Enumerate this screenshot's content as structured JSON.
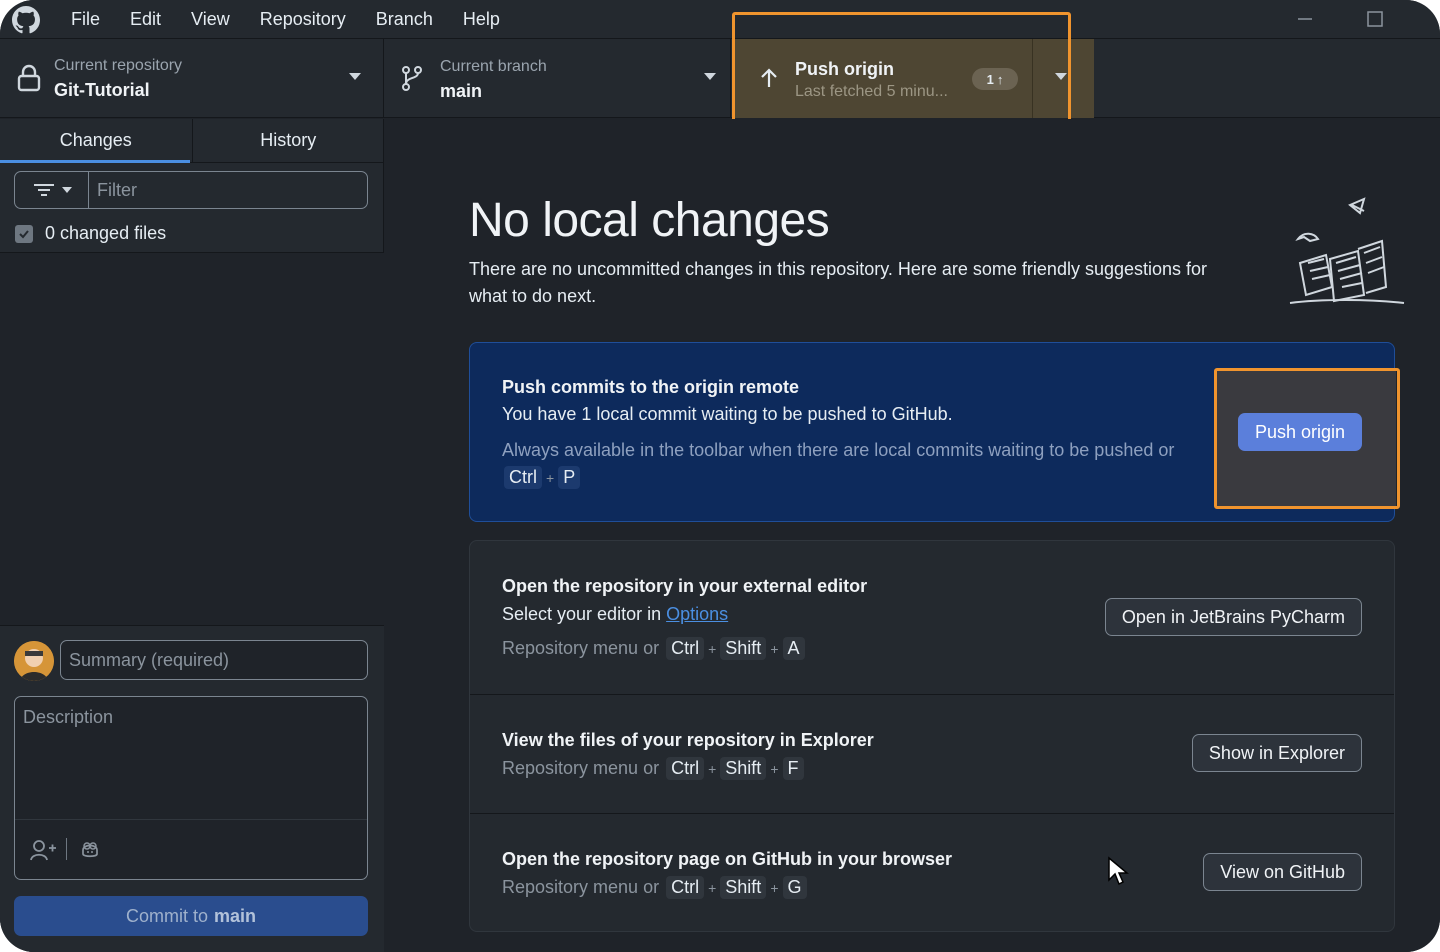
{
  "menu": [
    "File",
    "Edit",
    "View",
    "Repository",
    "Branch",
    "Help"
  ],
  "toolbar": {
    "repo": {
      "label": "Current repository",
      "value": "Git-Tutorial"
    },
    "branch": {
      "label": "Current branch",
      "value": "main"
    },
    "push": {
      "title": "Push origin",
      "subtitle": "Last fetched 5 minu...",
      "badge_count": "1"
    }
  },
  "sidebar": {
    "tabs": [
      "Changes",
      "History"
    ],
    "filter_placeholder": "Filter",
    "changed_files_label": "0 changed files",
    "summary_placeholder": "Summary (required)",
    "description_placeholder": "Description",
    "commit_button": {
      "prefix": "Commit to",
      "branch": "main"
    }
  },
  "main": {
    "title": "No local changes",
    "description": "There are no uncommitted changes in this repository. Here are some friendly suggestions for what to do next.",
    "push_card": {
      "title": "Push commits to the origin remote",
      "text": "You have 1 local commit waiting to be pushed to GitHub.",
      "hint": "Always available in the toolbar when there are local commits waiting to be pushed or",
      "keys": [
        "Ctrl",
        "P"
      ],
      "button": "Push origin"
    },
    "suggestions": [
      {
        "title": "Open the repository in your external editor",
        "text_prefix": "Select your editor in",
        "text_link": "Options",
        "hint": "Repository menu or",
        "keys": [
          "Ctrl",
          "Shift",
          "A"
        ],
        "button": "Open in JetBrains PyCharm"
      },
      {
        "title": "View the files of your repository in Explorer",
        "hint": "Repository menu or",
        "keys": [
          "Ctrl",
          "Shift",
          "F"
        ],
        "button": "Show in Explorer"
      },
      {
        "title": "Open the repository page on GitHub in your browser",
        "hint": "Repository menu or",
        "keys": [
          "Ctrl",
          "Shift",
          "G"
        ],
        "button": "View on GitHub"
      }
    ]
  },
  "colors": {
    "accent": "#4b8fe2",
    "highlight": "#f0942e",
    "push_card_bg": "#0d2a5c",
    "primary_button": "#5b7fdb"
  },
  "icons": [
    "github-logo-icon",
    "minimize-icon",
    "maximize-icon",
    "lock-icon",
    "branch-icon",
    "arrow-up-icon",
    "filter-icon",
    "checkbox-icon",
    "add-coauthor-icon",
    "copilot-icon",
    "mouse-cursor-icon"
  ]
}
